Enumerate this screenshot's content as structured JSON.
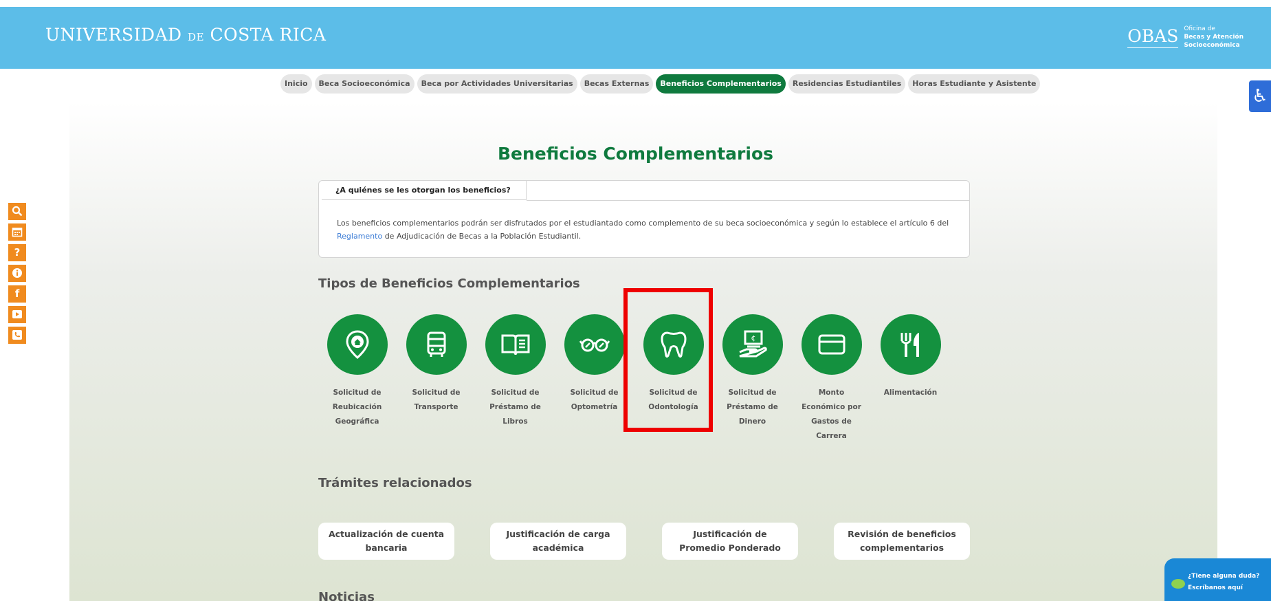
{
  "header": {
    "logo_main_1": "UNIVERSIDAD",
    "logo_de": "DE",
    "logo_main_2": "COSTA RICA",
    "obas_name": "OBAS",
    "obas_line1": "Oficina de",
    "obas_line2": "Becas y Atención",
    "obas_line3": "Socioeconómica"
  },
  "nav": {
    "tabs": [
      {
        "label": "Inicio",
        "active": false
      },
      {
        "label": "Beca Socioeconómica",
        "active": false
      },
      {
        "label": "Beca por Actividades Universitarias",
        "active": false
      },
      {
        "label": "Becas Externas",
        "active": false
      },
      {
        "label": "Beneficios Complementarios",
        "active": true
      },
      {
        "label": "Residencias Estudiantiles",
        "active": false
      },
      {
        "label": "Horas Estudiante y Asistente",
        "active": false
      }
    ]
  },
  "page": {
    "title": "Beneficios Complementarios"
  },
  "info": {
    "tab_label": "¿A quiénes se les otorgan los beneficios?",
    "text_before": "Los beneficios complementarios podrán ser disfrutados por el estudiantado como complemento de su beca socioeconómica y según lo establece el artículo 6 del ",
    "link_text": "Reglamento",
    "text_after": " de Adjudicación de Becas a la Población Estudiantil."
  },
  "types": {
    "title": "Tipos de Beneficios Complementarios",
    "items": [
      {
        "label": "Solicitud de Reubicación Geográfica",
        "icon": "location-home-icon"
      },
      {
        "label": "Solicitud de Transporte",
        "icon": "bus-icon"
      },
      {
        "label": "Solicitud de Préstamo de Libros",
        "icon": "book-icon"
      },
      {
        "label": "Solicitud de Optometría",
        "icon": "glasses-icon"
      },
      {
        "label": "Solicitud de Odontología",
        "icon": "tooth-icon"
      },
      {
        "label": "Solicitud de Préstamo de Dinero",
        "icon": "money-hand-icon"
      },
      {
        "label": "Monto Económico por Gastos de Carrera",
        "icon": "card-icon"
      },
      {
        "label": "Alimentación",
        "icon": "fork-knife-icon"
      }
    ]
  },
  "tramites": {
    "title": "Trámites relacionados",
    "items": [
      "Actualización de cuenta bancaria",
      "Justificación de carga académica",
      "Justificación de Promedio Ponderado",
      "Revisión de beneficios complementarios"
    ]
  },
  "news": {
    "title": "Noticias"
  },
  "side_icons": [
    "search-icon",
    "calendar-icon",
    "question-icon",
    "info-icon",
    "facebook-icon",
    "youtube-icon",
    "phone-icon"
  ],
  "chat": {
    "line1": "¿Tiene alguna duda?",
    "line2": "Escríbanos aquí"
  },
  "colors": {
    "header": "#5cbde8",
    "accent_green": "#0f7a3e",
    "icon_green": "#14913f",
    "side_orange": "#f08b1f",
    "highlight_red": "#ee0000"
  }
}
